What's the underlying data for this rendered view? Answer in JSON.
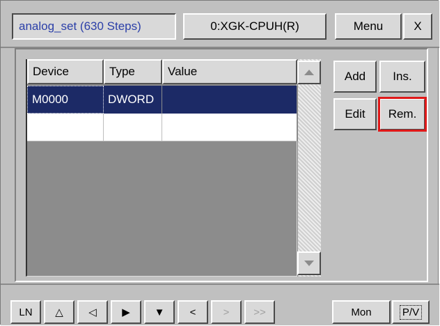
{
  "header": {
    "program_title": "analog_set (630 Steps)",
    "cpu_label": "0:XGK-CPUH(R)",
    "menu_label": "Menu",
    "close_label": "X"
  },
  "table": {
    "columns": [
      "Device",
      "Type",
      "Value"
    ],
    "rows": [
      {
        "device": "M0000",
        "type": "DWORD",
        "value": "",
        "selected": true
      },
      {
        "device": "",
        "type": "",
        "value": "",
        "selected": false
      }
    ]
  },
  "actions": {
    "add_label": "Add",
    "ins_label": "Ins.",
    "edit_label": "Edit",
    "rem_label": "Rem.",
    "highlighted": "Rem."
  },
  "footer": {
    "ln_label": "LN",
    "btn_up_outline": "△",
    "btn_left": "◁",
    "btn_right": "▶",
    "btn_down": "▼",
    "btn_lt": "<",
    "btn_gt": ">",
    "btn_gtgt": ">>",
    "mon_label": "Mon",
    "pv_label": "P/V"
  },
  "colors": {
    "selection": "#1c2a66",
    "title_text": "#2b3fa8",
    "highlight": "#e01818"
  }
}
